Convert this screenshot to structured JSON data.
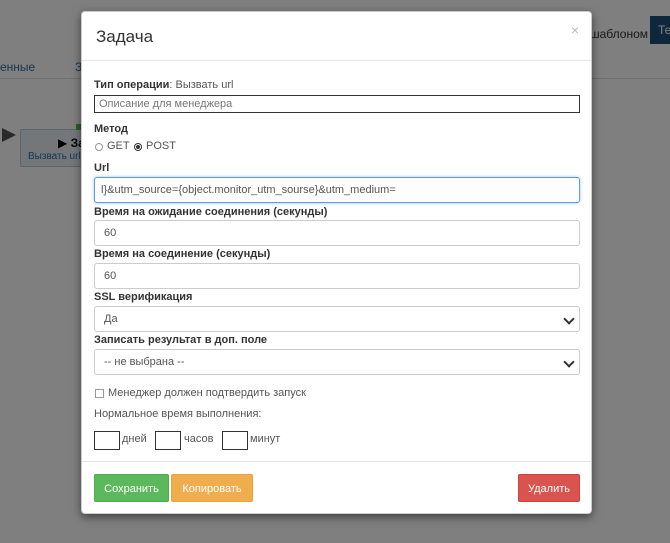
{
  "background": {
    "tab_left": "енные",
    "tab_mid": "З",
    "template_text": "шаблоном",
    "button_text": "Те",
    "node_title": "▶ За",
    "node_subtitle": "Вызвать url (к"
  },
  "modal": {
    "title": "Задача",
    "close_glyph": "×",
    "operation_type_label": "Тип операции",
    "operation_type_value": ": Вызвать url",
    "description_placeholder": "Описание для менеджера",
    "method_label": "Метод",
    "method_options": [
      {
        "label": "GET",
        "selected": false
      },
      {
        "label": "POST",
        "selected": true
      }
    ],
    "url_label": "Url",
    "url_value": "l}&utm_source={object.monitor_utm_sourse}&utm_medium={object.monitor_utm_medium}&utm_",
    "wait_timeout_label": "Время на ожидание соединения (секунды)",
    "wait_timeout_value": "60",
    "connect_timeout_label": "Время на соединение (секунды)",
    "connect_timeout_value": "60",
    "ssl_label": "SSL верификация",
    "ssl_value": "Да",
    "result_field_label": "Записать результат в доп. поле",
    "result_field_value": "-- не выбрана --",
    "confirm_label": "Менеджер должен подтвердить запуск",
    "normal_time_label": "Нормальное время выполнения:",
    "days_label": "дней",
    "hours_label": "часов",
    "minutes_label": "минут",
    "save_label": "Сохранить",
    "copy_label": "Копировать",
    "delete_label": "Удалить"
  }
}
